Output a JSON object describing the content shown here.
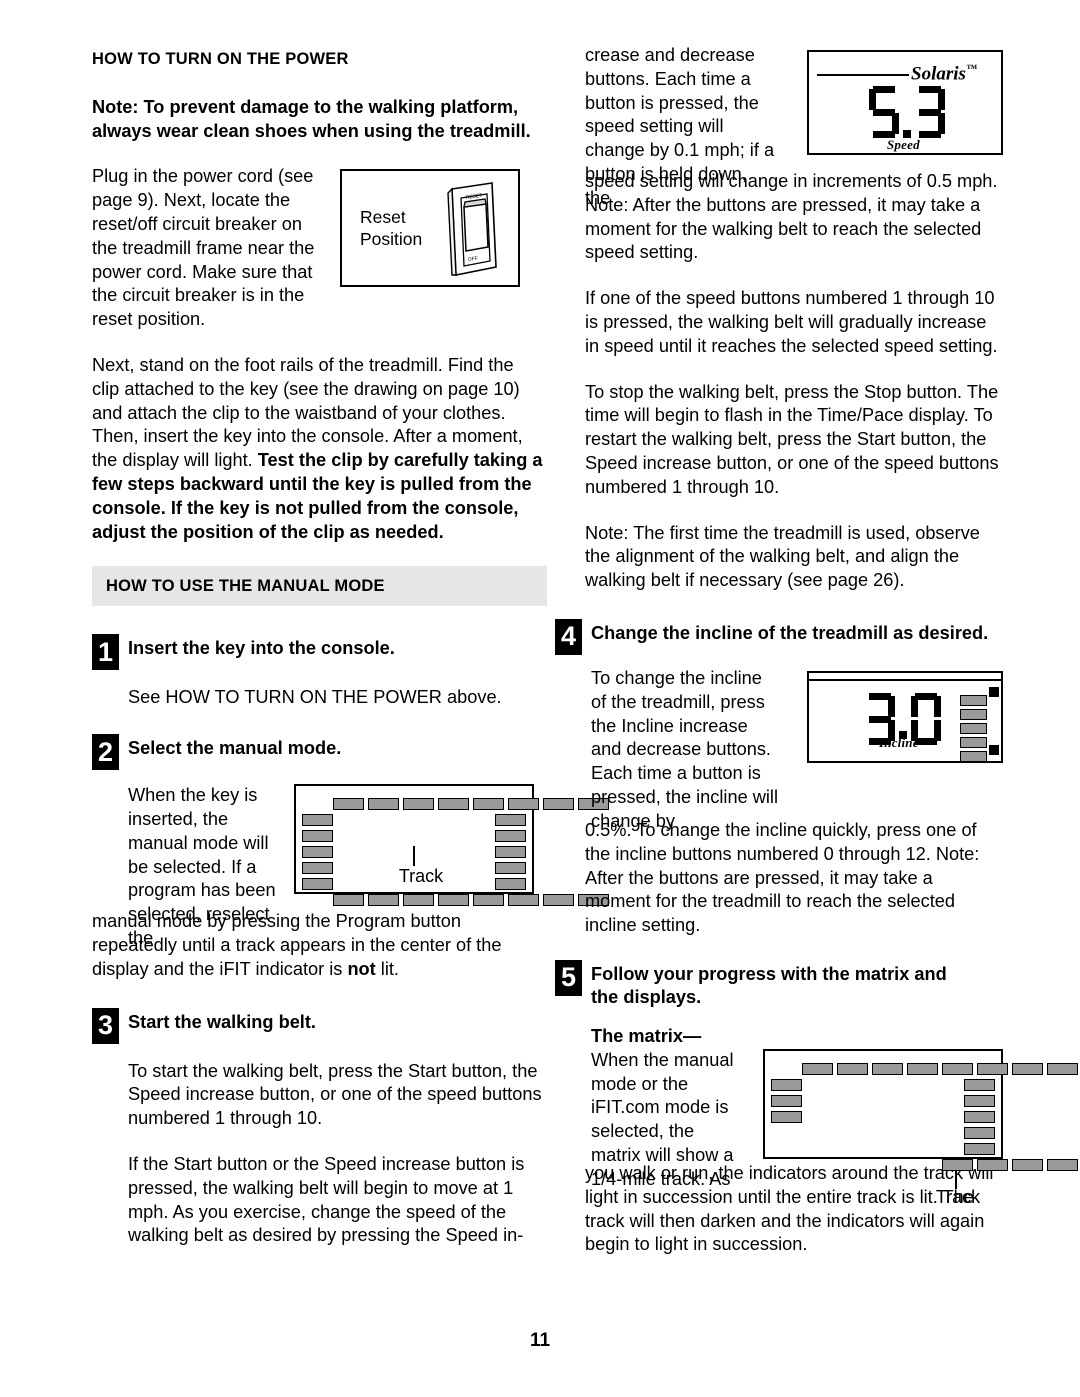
{
  "page_number": "11",
  "left_column": {
    "heading": "HOW TO TURN ON THE POWER",
    "note": "Note: To prevent damage to the walking platform, always wear clean shoes when using the treadmill.",
    "para1_a": "Plug in the power cord (see page 9). Next, locate the reset/off circuit breaker on the treadmill frame near the power cord. Make sure that the circuit breaker is in the reset position.",
    "reset_figure": {
      "label_line1": "Reset",
      "label_line2": "Position",
      "switch_top_text": "RESET",
      "switch_bottom_text": "OFF"
    },
    "para2_plain": "Next, stand on the foot rails of the treadmill. Find the clip attached to the key (see the drawing on page 10) and attach the clip to the waistband of your clothes. Then, insert the key into the console. After a moment, the display will light. ",
    "para2_bold": "Test the clip by carefully taking a few steps backward until the key is pulled from the console. If the key is not pulled from the console, adjust the position of the clip as needed.",
    "band_heading": "HOW TO USE THE MANUAL MODE",
    "steps": [
      {
        "number": "1",
        "title": "Insert the key into the console.",
        "body": "See HOW TO TURN ON THE POWER above."
      },
      {
        "number": "2",
        "title": "Select the manual mode.",
        "body_wrap": "When the key is inserted, the manual mode will be selected. If a program has been selected, reselect the",
        "body_full_a": "manual mode by pressing the Program button repeatedly until a track appears in the center of the display and the iFIT indicator is ",
        "body_full_bold": "not",
        "body_full_b": " lit.",
        "figure_label": "Track"
      },
      {
        "number": "3",
        "title": "Start the walking belt.",
        "body_a": "To start the walking belt, press the Start button, the Speed increase button, or one of the speed buttons numbered 1 through 10.",
        "body_b": "If the Start button or the Speed increase button is pressed, the walking belt will begin to move at 1 mph. As you exercise, change the speed of the walking belt as desired by pressing the Speed in-"
      }
    ]
  },
  "right_column": {
    "para_wrap": "crease and decrease buttons. Each time a button is pressed, the speed setting will change by 0.1 mph; if a button is held down, the",
    "speed_display": {
      "brand": "Solaris",
      "trademark": "™",
      "value": "5.3",
      "unit_label": "Speed"
    },
    "para_cont": "speed setting will change in increments of 0.5 mph. Note: After the buttons are pressed, it may take a moment for the walking belt to reach the selected speed setting.",
    "para_b": "If one of the speed buttons numbered 1 through 10 is pressed, the walking belt will gradually increase in speed until it reaches the selected speed setting.",
    "para_c": "To stop the walking belt, press the Stop button. The time will begin to flash in the Time/Pace display. To restart the walking belt, press the Start button, the Speed increase button, or one of the speed buttons numbered 1 through 10.",
    "para_d": "Note: The first time the treadmill is used, observe the alignment of the walking belt, and align the walking belt if necessary (see page 26).",
    "steps": [
      {
        "number": "4",
        "title": "Change the incline of the treadmill as desired.",
        "body_wrap": "To change the incline of the treadmill, press the Incline increase and decrease buttons. Each time a button is pressed, the incline will change by",
        "body_cont": "0.5%. To change the incline quickly, press one of the incline buttons numbered 0 through 12. Note: After the buttons are pressed, it may take a moment for the treadmill to reach the selected incline setting.",
        "incline_display": {
          "value": "3.0",
          "unit_label": "Incline"
        }
      },
      {
        "number": "5",
        "title": "Follow your progress with the matrix and the displays.",
        "sub_title": "The matrix—",
        "body_wrap": "When the manual mode or the iFIT.com mode is selected, the matrix will show a 1/4-mile track. As",
        "body_cont": "you walk or run, the indicators around the track will light in succession until the entire track is lit. The track will then darken and the indicators will again begin to light in succession.",
        "figure_label": "Track"
      }
    ]
  },
  "colors": {
    "band_gray": "#e6e6e6",
    "segment_gray": "#9a9a9a",
    "ink": "#000000",
    "paper": "#ffffff"
  }
}
